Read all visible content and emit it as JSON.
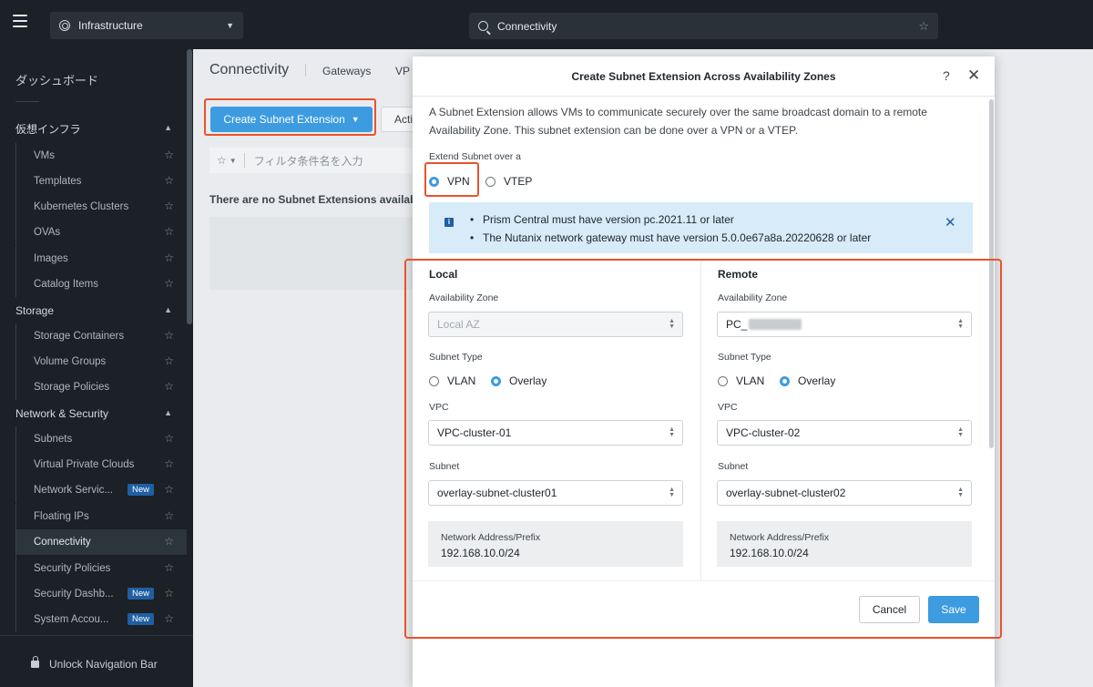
{
  "topbar": {
    "app_name": "Infrastructure",
    "search_value": "Connectivity"
  },
  "sidebar": {
    "dashboard": "ダッシュボード",
    "sections": [
      {
        "title": "仮想インフラ",
        "items": [
          {
            "label": "VMs"
          },
          {
            "label": "Templates"
          },
          {
            "label": "Kubernetes Clusters"
          },
          {
            "label": "OVAs"
          },
          {
            "label": "Images"
          },
          {
            "label": "Catalog Items"
          }
        ]
      },
      {
        "title": "Storage",
        "items": [
          {
            "label": "Storage Containers"
          },
          {
            "label": "Volume Groups"
          },
          {
            "label": "Storage Policies"
          }
        ]
      },
      {
        "title": "Network & Security",
        "items": [
          {
            "label": "Subnets"
          },
          {
            "label": "Virtual Private Clouds"
          },
          {
            "label": "Network Servic...",
            "badge": "New"
          },
          {
            "label": "Floating IPs"
          },
          {
            "label": "Connectivity"
          },
          {
            "label": "Security Policies"
          },
          {
            "label": "Security Dashb...",
            "badge": "New"
          },
          {
            "label": "System Accou...",
            "badge": "New"
          }
        ]
      }
    ],
    "unlock_label": "Unlock Navigation Bar"
  },
  "main": {
    "title": "Connectivity",
    "tabs": [
      "Gateways",
      "VP"
    ],
    "create_button": "Create Subnet Extension",
    "actions_button": "Acti",
    "filter_placeholder": "フィルタ条件名を入力",
    "empty_message": "There are no Subnet Extensions availabl"
  },
  "modal": {
    "title": "Create Subnet Extension Across Availability Zones",
    "help": "?",
    "description": "A Subnet Extension allows VMs to communicate securely over the same broadcast domain to a remote Availability Zone. This subnet extension can be done over a VPN or a VTEP.",
    "extend_label": "Extend Subnet over a",
    "extend_options": [
      "VPN",
      "VTEP"
    ],
    "extend_selected": "VPN",
    "info": [
      "Prism Central must have version pc.2021.11 or later",
      "The Nutanix network gateway must have version 5.0.0e67a8a.20220628 or later"
    ],
    "local": {
      "title": "Local",
      "az_label": "Availability Zone",
      "az_value": "Local AZ",
      "subnet_type_label": "Subnet Type",
      "subnet_type_options": [
        "VLAN",
        "Overlay"
      ],
      "subnet_type_selected": "Overlay",
      "vpc_label": "VPC",
      "vpc_value": "VPC-cluster-01",
      "subnet_label": "Subnet",
      "subnet_value": "overlay-subnet-cluster01",
      "net_label": "Network Address/Prefix",
      "net_value": "192.168.10.0/24"
    },
    "remote": {
      "title": "Remote",
      "az_label": "Availability Zone",
      "az_value": "PC_",
      "subnet_type_label": "Subnet Type",
      "subnet_type_options": [
        "VLAN",
        "Overlay"
      ],
      "subnet_type_selected": "Overlay",
      "vpc_label": "VPC",
      "vpc_value": "VPC-cluster-02",
      "subnet_label": "Subnet",
      "subnet_value": "overlay-subnet-cluster02",
      "net_label": "Network Address/Prefix",
      "net_value": "192.168.10.0/24"
    },
    "cancel": "Cancel",
    "save": "Save"
  },
  "colors": {
    "accent": "#3d9be0",
    "highlight": "#e8532c",
    "sidebar_bg": "#1b2127",
    "info_bg": "#d7ebf9"
  },
  "icons": [
    "hamburger-icon",
    "app-switcher-icon",
    "search-icon",
    "star-icon",
    "chevron-up-icon",
    "lock-icon",
    "help-icon",
    "close-icon",
    "info-icon",
    "select-arrows-icon"
  ]
}
